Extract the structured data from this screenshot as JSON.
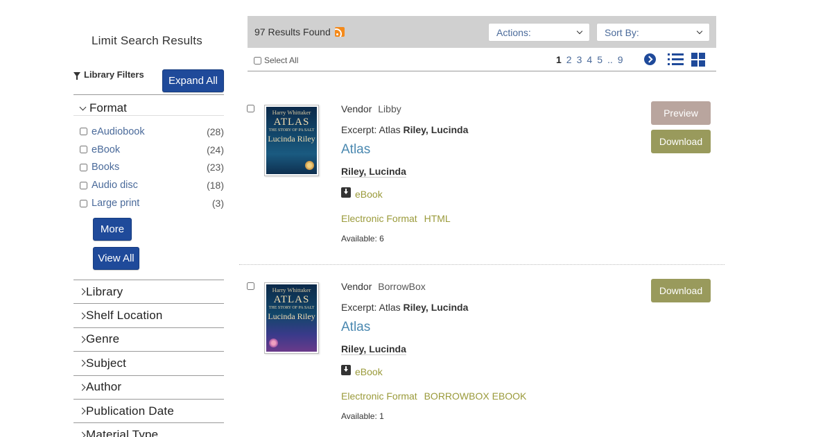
{
  "sidebar": {
    "title": "Limit Search Results",
    "library_filters_label": "Library Filters",
    "expand_all_label": "Expand All",
    "format": {
      "heading": "Format",
      "items": [
        {
          "label": "eAudiobook",
          "count": "(28)"
        },
        {
          "label": "eBook",
          "count": "(24)"
        },
        {
          "label": "Books",
          "count": "(23)"
        },
        {
          "label": "Audio disc",
          "count": "(18)"
        },
        {
          "label": "Large print",
          "count": "(3)"
        }
      ],
      "more_label": "More",
      "view_all_label": "View All"
    },
    "collapsed_facets": [
      {
        "label": "Library"
      },
      {
        "label": "Shelf Location"
      },
      {
        "label": "Genre"
      },
      {
        "label": "Subject"
      },
      {
        "label": "Author"
      },
      {
        "label": "Publication Date"
      },
      {
        "label": "Material Type"
      }
    ]
  },
  "results": {
    "count_text": "97 Results Found",
    "actions_placeholder": "Actions:",
    "sort_placeholder": "Sort By:",
    "select_all_label": "Select All",
    "pages": [
      "1",
      "2",
      "3",
      "4",
      "5",
      "..",
      "9"
    ],
    "current_page": "1"
  },
  "records": [
    {
      "vendor_label": "Vendor",
      "vendor": "Libby",
      "excerpt_label": "Excerpt:",
      "excerpt_title": "Atlas",
      "excerpt_author": "Riley, Lucinda",
      "title": "Atlas",
      "author": "Riley, Lucinda",
      "format": "eBook",
      "eformat_label": "Electronic Format",
      "eformat": "HTML",
      "available": "Available: 6",
      "preview_label": "Preview",
      "download_label": "Download",
      "cover": {
        "author_top": "Harry Whittaker",
        "title": "ATLAS",
        "subtitle": "THE STORY OF PA SALT",
        "author": "Lucinda Riley"
      }
    },
    {
      "vendor_label": "Vendor",
      "vendor": "BorrowBox",
      "excerpt_label": "Excerpt:",
      "excerpt_title": "Atlas",
      "excerpt_author": "Riley, Lucinda",
      "title": "Atlas",
      "author": "Riley, Lucinda",
      "format": "eBook",
      "eformat_label": "Electronic Format",
      "eformat": "BORROWBOX EBOOK",
      "available": "Available: 1",
      "download_label": "Download",
      "cover": {
        "author_top": "Harry Whittaker",
        "title": "ATLAS",
        "subtitle": "THE STORY OF PA SALT",
        "author": "Lucinda Riley"
      }
    }
  ],
  "colors": {
    "primary_blue": "#1f4a9a",
    "link_blue": "#4a88b0",
    "format_olive": "#9a9a3a",
    "download_olive": "#999a5c",
    "preview_taupe": "#b9a59e",
    "header_gray": "#d0d0d0",
    "rss_orange": "#f48a1b"
  },
  "icons": {
    "filter": "funnel-icon",
    "rss": "rss-icon",
    "next_page": "circle-chevron-right-icon",
    "list_view": "list-view-icon",
    "grid_view": "grid-view-icon",
    "format_download": "download-box-icon"
  }
}
